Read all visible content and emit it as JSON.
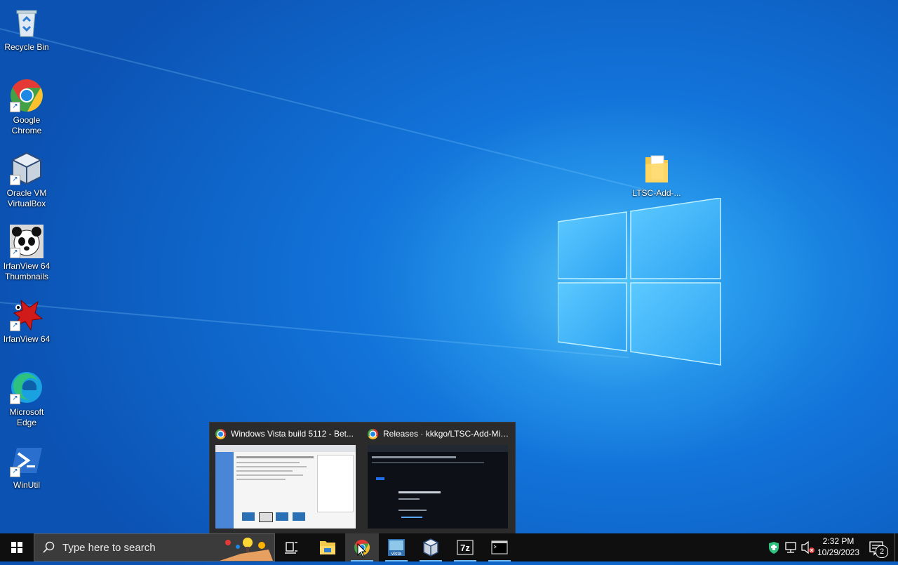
{
  "desktop": {
    "icons": [
      {
        "label": "Recycle Bin",
        "icon": "recycle-bin-icon"
      },
      {
        "label": "Google\nChrome",
        "icon": "chrome-icon"
      },
      {
        "label": "Oracle VM\nVirtualBox",
        "icon": "virtualbox-icon"
      },
      {
        "label": "IrfanView 64\nThumbnails",
        "icon": "panda-icon"
      },
      {
        "label": "IrfanView 64",
        "icon": "irfanview-icon"
      },
      {
        "label": "Microsoft\nEdge",
        "icon": "edge-icon"
      },
      {
        "label": "WinUtil",
        "icon": "powershell-icon"
      }
    ],
    "folder": {
      "label": "LTSC-Add-...",
      "icon": "folder-icon"
    }
  },
  "thumbnails": [
    {
      "title": "Windows Vista build 5112 - Bet...",
      "icon": "chrome-icon"
    },
    {
      "title": "Releases · kkkgo/LTSC-Add-Mic...",
      "icon": "chrome-icon"
    }
  ],
  "taskbar": {
    "search_placeholder": "Type here to search",
    "apps": [
      "start-icon",
      "task-view-icon",
      "file-explorer-icon",
      "chrome-icon",
      "vista-icon",
      "virtualbox-icon",
      "7zip-icon",
      "terminal-icon"
    ],
    "zip_label": "7z",
    "vista_label": "vista",
    "time": "2:32 PM",
    "date": "10/29/2023",
    "notification_count": "2"
  },
  "colors": {
    "taskbar": "#0f0f10",
    "accent": "#76b9ed",
    "desktop": "#1273d9"
  }
}
